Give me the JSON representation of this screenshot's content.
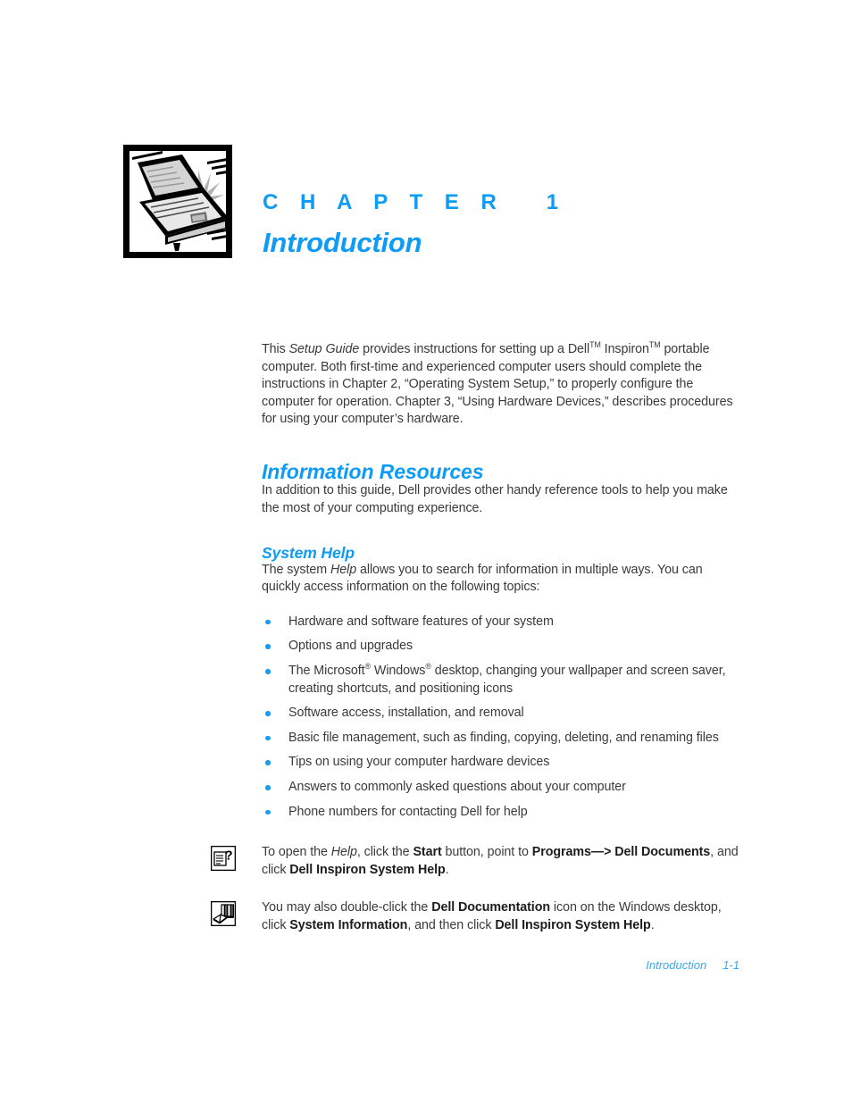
{
  "chapter": {
    "label": "C H A P T E R   1",
    "title": "Introduction",
    "icon_name": "laptop-computer-illustration"
  },
  "intro_paragraph": {
    "part1": "This ",
    "italic1": "Setup Guide",
    "part2": " provides instructions for setting up a Dell",
    "sup1": "TM",
    "part3": " Inspiron",
    "sup2": "TM",
    "part4": " portable computer. Both first-time and experienced computer users should complete the instructions in Chapter 2, “Operating System Setup,” to properly configure the computer for operation. Chapter 3, “Using Hardware Devices,” describes procedures for using your computer’s hardware."
  },
  "information_resources": {
    "heading": "Information Resources",
    "paragraph": "In addition to this guide, Dell provides other handy reference tools to help you make the most of your computing experience."
  },
  "system_help": {
    "heading": "System Help",
    "intro_part1": "The system ",
    "intro_italic": "Help",
    "intro_part2": " allows you to search for information in multiple ways. You can quickly access information on the following topics:",
    "bullets": [
      {
        "text": "Hardware and software features of your system"
      },
      {
        "text": "Options and upgrades"
      },
      {
        "part1": "The Microsoft",
        "sup1": "®",
        "part2": " Windows",
        "sup2": "®",
        "part3": " desktop, changing your wallpaper and screen saver, creating shortcuts, and positioning icons"
      },
      {
        "text": "Software access, installation, and removal"
      },
      {
        "text": "Basic file management, such as finding, copying, deleting, and renaming files"
      },
      {
        "text": "Tips on using your computer hardware devices"
      },
      {
        "text": "Answers to commonly asked questions about your computer"
      },
      {
        "text": "Phone numbers for contacting Dell for help"
      }
    ],
    "note1": {
      "icon_name": "help-document-icon",
      "part1": "To open the ",
      "italic1": "Help",
      "part2": ", click the ",
      "bold1": "Start",
      "part3": " button, point to ",
      "bold2": "Programs—> Dell Documents",
      "part4": ", and click ",
      "bold3": "Dell Inspiron System Help",
      "part5": "."
    },
    "note2": {
      "icon_name": "documentation-books-icon",
      "part1": "You may also double-click the ",
      "bold1": "Dell Documentation",
      "part2": " icon on the Windows desktop, click ",
      "bold2": "System Information",
      "part3": ", and then click ",
      "bold3": "Dell Inspiron System Help",
      "part4": "."
    }
  },
  "footer": {
    "chapter_name": "Introduction",
    "page_number": "1-1"
  },
  "colors": {
    "accent_blue": "#0d9bf5",
    "footer_blue": "#3aa8f2",
    "body_text": "#3a3a3a",
    "bullet_blue": "#1a9cf0"
  }
}
